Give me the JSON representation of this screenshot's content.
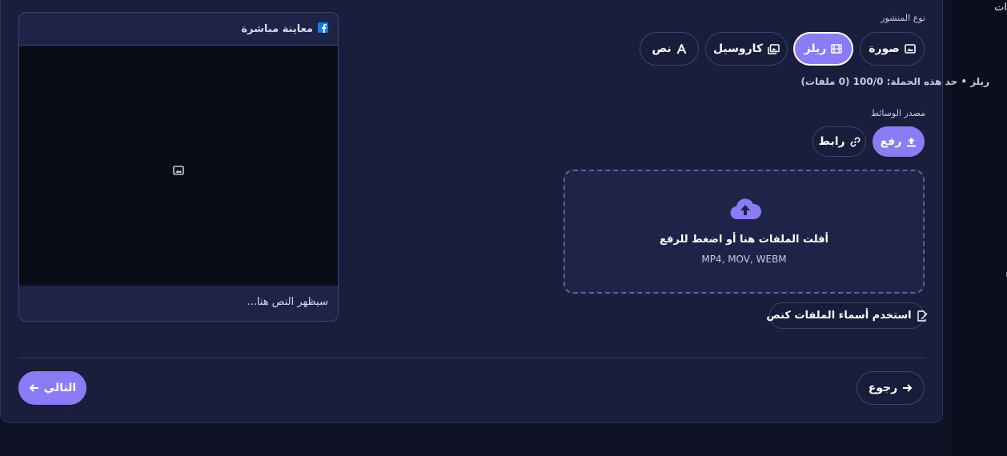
{
  "sidebar": {
    "partial_text": "ات"
  },
  "post_type": {
    "label": "نوع المنشور",
    "options": [
      {
        "label": "صورة",
        "icon": "image-icon",
        "active": false
      },
      {
        "label": "ريلز",
        "icon": "film-icon",
        "active": true
      },
      {
        "label": "كاروسيل",
        "icon": "images-icon",
        "active": false
      },
      {
        "label": "نص",
        "icon": "text-icon",
        "active": false
      }
    ]
  },
  "limit": {
    "text": "ريلز • حد هذه الحملة: 100/0 (0 ملفات)"
  },
  "media_source": {
    "label": "مصدر الوسائط",
    "options": [
      {
        "label": "رفع",
        "icon": "upload-icon",
        "active": true
      },
      {
        "label": "رابط",
        "icon": "link-icon",
        "active": false
      }
    ]
  },
  "dropzone": {
    "title": "أفلت الملفات هنا أو اضغط للرفع",
    "formats": "MP4, MOV, WEBM"
  },
  "filenames_button": {
    "label": "استخدم أسماء الملفات كنص",
    "icon": "file-signature-icon"
  },
  "preview": {
    "title": "معاينة مباشرة",
    "platform_icon": "facebook-icon",
    "placeholder_icon": "image-icon",
    "caption": "سيظهر النص هنا..."
  },
  "navigation": {
    "back_label": "رجوع",
    "next_label": "التالي"
  },
  "colors": {
    "accent": "#8b7cf6",
    "panel": "#181e3c",
    "page": "#0e1224"
  }
}
